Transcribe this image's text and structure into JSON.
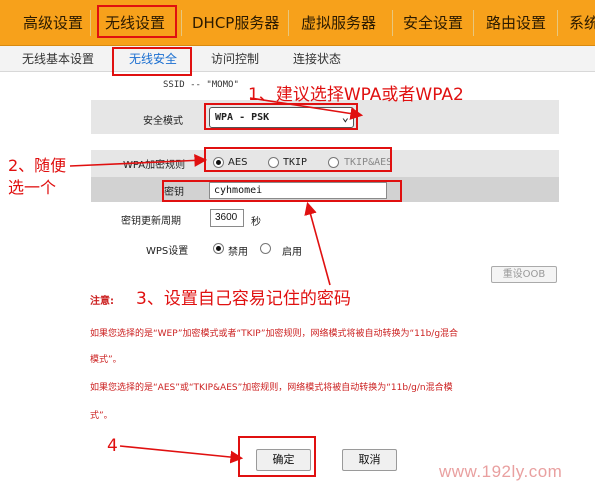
{
  "top_nav": [
    "高级设置",
    "无线设置",
    "DHCP服务器",
    "虚拟服务器",
    "安全设置",
    "路由设置",
    "系统"
  ],
  "sub_nav": [
    "无线基本设置",
    "无线安全",
    "访问控制",
    "连接状态"
  ],
  "ssid_line": "SSID -- \"MOMO\"",
  "security_mode": {
    "label": "安全模式",
    "value": "WPA - PSK"
  },
  "cipher": {
    "label": "WPA加密规则",
    "options": [
      "AES",
      "TKIP",
      "TKIP&AES"
    ],
    "selected": "AES"
  },
  "key": {
    "label": "密钥",
    "value": "cyhmomei"
  },
  "renew": {
    "label": "密钥更新周期",
    "value": "3600",
    "unit": "秒"
  },
  "wps": {
    "label": "WPS设置",
    "options": [
      "禁用",
      "启用"
    ],
    "selected": "禁用",
    "reset_label": "重设OOB"
  },
  "notes": {
    "title": "注意:",
    "line1": "如果您选择的是“WEP”加密模式或者“TKIP”加密规则，网络模式将被自动转换为“11b/g混合",
    "line1b": "模式”。",
    "line2": "如果您选择的是“AES”或“TKIP&AES”加密规则，网络模式将被自动转换为“11b/g/n混合模",
    "line2b": "式”。"
  },
  "buttons": {
    "ok": "确定",
    "cancel": "取消"
  },
  "annotations": {
    "a1": "1、建议选择WPA或者WPA2",
    "a2a": "2、随便",
    "a2b": "选一个",
    "a3": "3、设置自己容易记住的密码",
    "a4": "4"
  },
  "watermark": "www.192ly.com",
  "colors": {
    "nav_bg": "#f7a11b",
    "annotation_red": "#e01010",
    "note_red": "#cc2222",
    "active_tab": "#1a6fd1"
  }
}
